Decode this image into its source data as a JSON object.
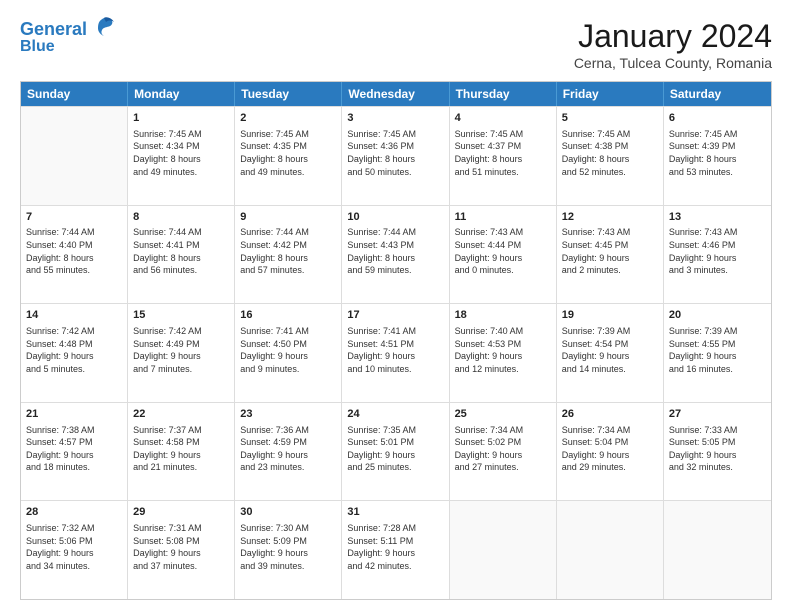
{
  "header": {
    "logo_line1": "General",
    "logo_line2": "Blue",
    "month_year": "January 2024",
    "location": "Cerna, Tulcea County, Romania"
  },
  "weekdays": [
    "Sunday",
    "Monday",
    "Tuesday",
    "Wednesday",
    "Thursday",
    "Friday",
    "Saturday"
  ],
  "rows": [
    [
      {
        "day": "",
        "text": ""
      },
      {
        "day": "1",
        "text": "Sunrise: 7:45 AM\nSunset: 4:34 PM\nDaylight: 8 hours\nand 49 minutes."
      },
      {
        "day": "2",
        "text": "Sunrise: 7:45 AM\nSunset: 4:35 PM\nDaylight: 8 hours\nand 49 minutes."
      },
      {
        "day": "3",
        "text": "Sunrise: 7:45 AM\nSunset: 4:36 PM\nDaylight: 8 hours\nand 50 minutes."
      },
      {
        "day": "4",
        "text": "Sunrise: 7:45 AM\nSunset: 4:37 PM\nDaylight: 8 hours\nand 51 minutes."
      },
      {
        "day": "5",
        "text": "Sunrise: 7:45 AM\nSunset: 4:38 PM\nDaylight: 8 hours\nand 52 minutes."
      },
      {
        "day": "6",
        "text": "Sunrise: 7:45 AM\nSunset: 4:39 PM\nDaylight: 8 hours\nand 53 minutes."
      }
    ],
    [
      {
        "day": "7",
        "text": "Sunrise: 7:44 AM\nSunset: 4:40 PM\nDaylight: 8 hours\nand 55 minutes."
      },
      {
        "day": "8",
        "text": "Sunrise: 7:44 AM\nSunset: 4:41 PM\nDaylight: 8 hours\nand 56 minutes."
      },
      {
        "day": "9",
        "text": "Sunrise: 7:44 AM\nSunset: 4:42 PM\nDaylight: 8 hours\nand 57 minutes."
      },
      {
        "day": "10",
        "text": "Sunrise: 7:44 AM\nSunset: 4:43 PM\nDaylight: 8 hours\nand 59 minutes."
      },
      {
        "day": "11",
        "text": "Sunrise: 7:43 AM\nSunset: 4:44 PM\nDaylight: 9 hours\nand 0 minutes."
      },
      {
        "day": "12",
        "text": "Sunrise: 7:43 AM\nSunset: 4:45 PM\nDaylight: 9 hours\nand 2 minutes."
      },
      {
        "day": "13",
        "text": "Sunrise: 7:43 AM\nSunset: 4:46 PM\nDaylight: 9 hours\nand 3 minutes."
      }
    ],
    [
      {
        "day": "14",
        "text": "Sunrise: 7:42 AM\nSunset: 4:48 PM\nDaylight: 9 hours\nand 5 minutes."
      },
      {
        "day": "15",
        "text": "Sunrise: 7:42 AM\nSunset: 4:49 PM\nDaylight: 9 hours\nand 7 minutes."
      },
      {
        "day": "16",
        "text": "Sunrise: 7:41 AM\nSunset: 4:50 PM\nDaylight: 9 hours\nand 9 minutes."
      },
      {
        "day": "17",
        "text": "Sunrise: 7:41 AM\nSunset: 4:51 PM\nDaylight: 9 hours\nand 10 minutes."
      },
      {
        "day": "18",
        "text": "Sunrise: 7:40 AM\nSunset: 4:53 PM\nDaylight: 9 hours\nand 12 minutes."
      },
      {
        "day": "19",
        "text": "Sunrise: 7:39 AM\nSunset: 4:54 PM\nDaylight: 9 hours\nand 14 minutes."
      },
      {
        "day": "20",
        "text": "Sunrise: 7:39 AM\nSunset: 4:55 PM\nDaylight: 9 hours\nand 16 minutes."
      }
    ],
    [
      {
        "day": "21",
        "text": "Sunrise: 7:38 AM\nSunset: 4:57 PM\nDaylight: 9 hours\nand 18 minutes."
      },
      {
        "day": "22",
        "text": "Sunrise: 7:37 AM\nSunset: 4:58 PM\nDaylight: 9 hours\nand 21 minutes."
      },
      {
        "day": "23",
        "text": "Sunrise: 7:36 AM\nSunset: 4:59 PM\nDaylight: 9 hours\nand 23 minutes."
      },
      {
        "day": "24",
        "text": "Sunrise: 7:35 AM\nSunset: 5:01 PM\nDaylight: 9 hours\nand 25 minutes."
      },
      {
        "day": "25",
        "text": "Sunrise: 7:34 AM\nSunset: 5:02 PM\nDaylight: 9 hours\nand 27 minutes."
      },
      {
        "day": "26",
        "text": "Sunrise: 7:34 AM\nSunset: 5:04 PM\nDaylight: 9 hours\nand 29 minutes."
      },
      {
        "day": "27",
        "text": "Sunrise: 7:33 AM\nSunset: 5:05 PM\nDaylight: 9 hours\nand 32 minutes."
      }
    ],
    [
      {
        "day": "28",
        "text": "Sunrise: 7:32 AM\nSunset: 5:06 PM\nDaylight: 9 hours\nand 34 minutes."
      },
      {
        "day": "29",
        "text": "Sunrise: 7:31 AM\nSunset: 5:08 PM\nDaylight: 9 hours\nand 37 minutes."
      },
      {
        "day": "30",
        "text": "Sunrise: 7:30 AM\nSunset: 5:09 PM\nDaylight: 9 hours\nand 39 minutes."
      },
      {
        "day": "31",
        "text": "Sunrise: 7:28 AM\nSunset: 5:11 PM\nDaylight: 9 hours\nand 42 minutes."
      },
      {
        "day": "",
        "text": ""
      },
      {
        "day": "",
        "text": ""
      },
      {
        "day": "",
        "text": ""
      }
    ]
  ]
}
